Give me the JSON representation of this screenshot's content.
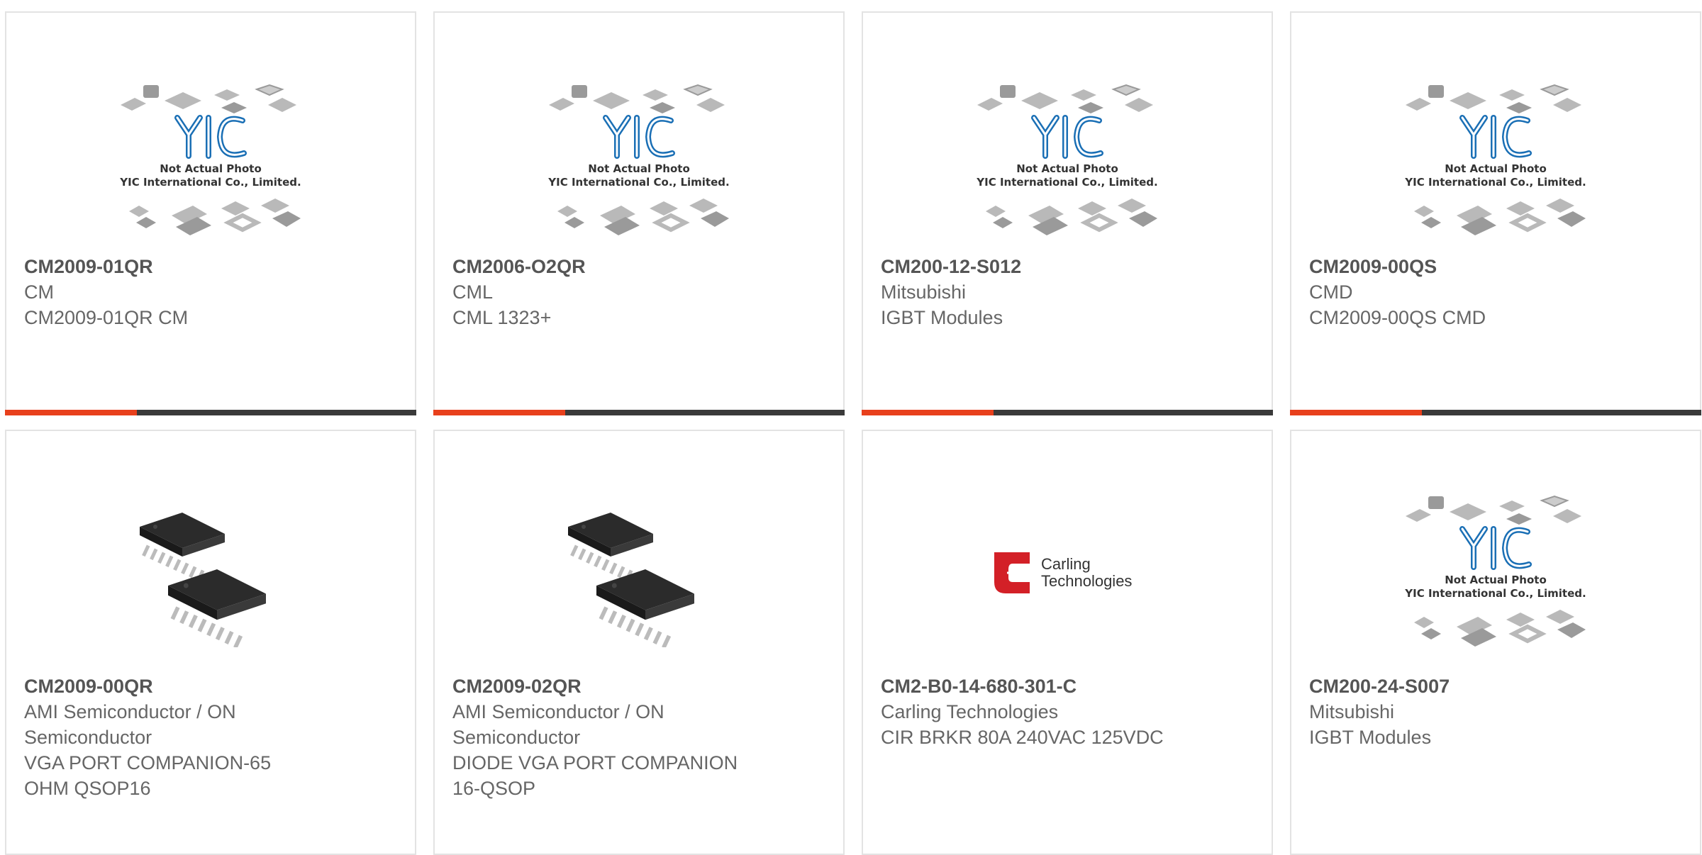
{
  "placeholder": {
    "caption_line1": "Not Actual Photo",
    "caption_line2": "YIC International Co., Limited.",
    "logo_text": "YIC"
  },
  "carling_logo": {
    "line1": "Carling",
    "line2": "Technologies"
  },
  "colors": {
    "accent": "#e8401c",
    "bar": "#3a3a3a",
    "yic_blue": "#1a6fb5"
  },
  "products": [
    {
      "part_number": "CM2009-01QR",
      "manufacturer": "CM",
      "description": "CM2009-01QR CM",
      "image": "yic-placeholder"
    },
    {
      "part_number": "CM2006-O2QR",
      "manufacturer": "CML",
      "description": "CML 1323+",
      "image": "yic-placeholder"
    },
    {
      "part_number": "CM200-12-S012",
      "manufacturer": "Mitsubishi",
      "description": "IGBT Modules",
      "image": "yic-placeholder"
    },
    {
      "part_number": "CM2009-00QS",
      "manufacturer": "CMD",
      "description": "CM2009-00QS CMD",
      "image": "yic-placeholder"
    },
    {
      "part_number": "CM2009-00QR",
      "manufacturer_l1": "AMI Semiconductor / ON",
      "manufacturer_l2": "Semiconductor",
      "description_l1": "VGA PORT COMPANION-65",
      "description_l2": "OHM QSOP16",
      "image": "chip-photo"
    },
    {
      "part_number": "CM2009-02QR",
      "manufacturer_l1": "AMI Semiconductor / ON",
      "manufacturer_l2": "Semiconductor",
      "description_l1": "DIODE VGA PORT COMPANION",
      "description_l2": "16-QSOP",
      "image": "chip-photo"
    },
    {
      "part_number": "CM2-B0-14-680-301-C",
      "manufacturer": "Carling Technologies",
      "description": "CIR BRKR 80A 240VAC 125VDC",
      "image": "carling-logo"
    },
    {
      "part_number": "CM200-24-S007",
      "manufacturer": "Mitsubishi",
      "description": "IGBT Modules",
      "image": "yic-placeholder"
    }
  ]
}
